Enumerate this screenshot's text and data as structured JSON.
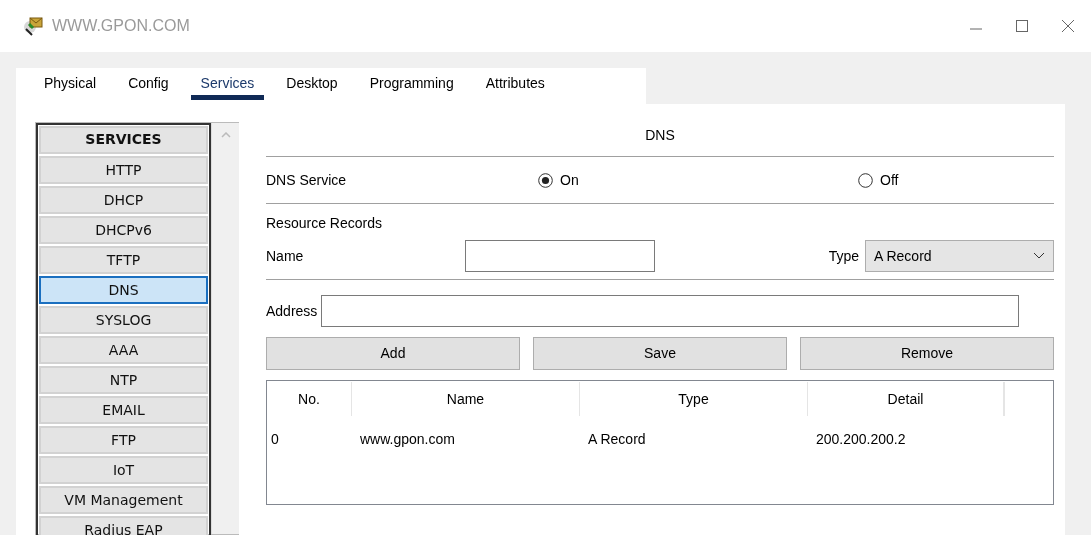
{
  "window": {
    "title": "WWW.GPON.COM"
  },
  "tabs": [
    {
      "label": "Physical",
      "selected": false
    },
    {
      "label": "Config",
      "selected": false
    },
    {
      "label": "Services",
      "selected": true
    },
    {
      "label": "Desktop",
      "selected": false
    },
    {
      "label": "Programming",
      "selected": false
    },
    {
      "label": "Attributes",
      "selected": false
    }
  ],
  "sidebar": {
    "heading": "SERVICES",
    "items": [
      {
        "label": "HTTP",
        "selected": false
      },
      {
        "label": "DHCP",
        "selected": false
      },
      {
        "label": "DHCPv6",
        "selected": false
      },
      {
        "label": "TFTP",
        "selected": false
      },
      {
        "label": "DNS",
        "selected": true
      },
      {
        "label": "SYSLOG",
        "selected": false
      },
      {
        "label": "AAA",
        "selected": false
      },
      {
        "label": "NTP",
        "selected": false
      },
      {
        "label": "EMAIL",
        "selected": false
      },
      {
        "label": "FTP",
        "selected": false
      },
      {
        "label": "IoT",
        "selected": false
      },
      {
        "label": "VM Management",
        "selected": false
      },
      {
        "label": "Radius EAP",
        "selected": false
      }
    ]
  },
  "dns": {
    "title": "DNS",
    "service_label": "DNS Service",
    "service_options": [
      {
        "label": "On",
        "selected": true
      },
      {
        "label": "Off",
        "selected": false
      }
    ],
    "records_label": "Resource Records",
    "name_label": "Name",
    "type_label": "Type",
    "type_value": "A Record",
    "address_label": "Address",
    "buttons": [
      "Add",
      "Save",
      "Remove"
    ],
    "table": {
      "columns": [
        "No.",
        "Name",
        "Type",
        "Detail"
      ],
      "rows": [
        [
          "0",
          "www.gpon.com",
          "A Record",
          "200.200.200.2"
        ]
      ]
    }
  }
}
